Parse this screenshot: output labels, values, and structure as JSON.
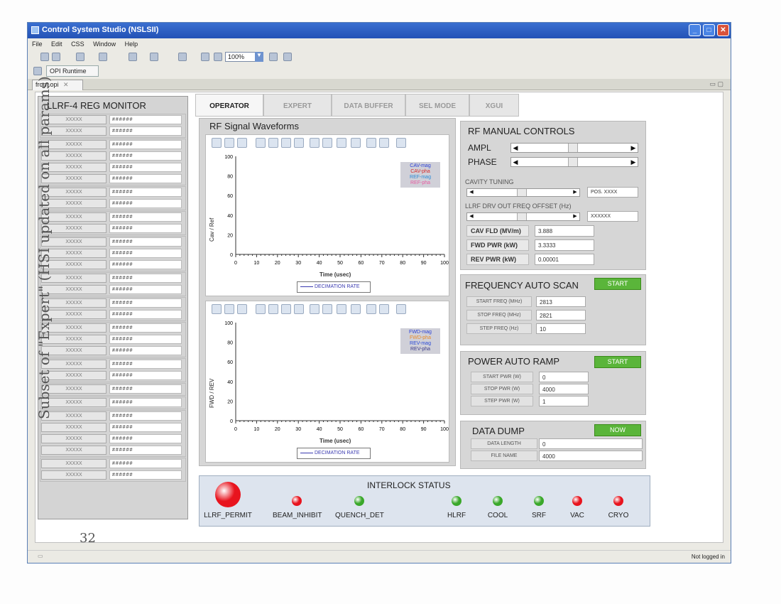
{
  "window": {
    "title": "Control System Studio (NSLSII)"
  },
  "menu": [
    "File",
    "Edit",
    "CSS",
    "Window",
    "Help"
  ],
  "toolbar": {
    "zoom": "100%"
  },
  "perspective": {
    "label": "OPI Runtime"
  },
  "editor_tab": {
    "label": "front.opi"
  },
  "status": {
    "login": "Not logged in"
  },
  "monitor": {
    "title": "LLRF-4 REG MONITOR",
    "rows": [
      {
        "key": "XXXXX",
        "val": "######"
      },
      {
        "key": "XXXXX",
        "val": "######"
      },
      {
        "key": "XXXXX",
        "val": "######"
      },
      {
        "key": "XXXXX",
        "val": "######"
      },
      {
        "key": "XXXXX",
        "val": "######"
      },
      {
        "key": "XXXXX",
        "val": "######"
      },
      {
        "key": "XXXXX",
        "val": "######"
      },
      {
        "key": "XXXXX",
        "val": "######"
      },
      {
        "key": "XXXXX",
        "val": "######"
      },
      {
        "key": "XXXXX",
        "val": "######"
      },
      {
        "key": "XXXXX",
        "val": "######"
      },
      {
        "key": "XXXXX",
        "val": "######"
      },
      {
        "key": "XXXXX",
        "val": "######"
      },
      {
        "key": "XXXXX",
        "val": "######"
      },
      {
        "key": "XXXXX",
        "val": "######"
      },
      {
        "key": "XXXXX",
        "val": "######"
      },
      {
        "key": "XXXXX",
        "val": "######"
      },
      {
        "key": "XXXXX",
        "val": "######"
      },
      {
        "key": "XXXXX",
        "val": "######"
      },
      {
        "key": "XXXXX",
        "val": "######"
      },
      {
        "key": "XXXXX",
        "val": "######"
      },
      {
        "key": "XXXXX",
        "val": "######"
      },
      {
        "key": "XXXXX",
        "val": "######"
      },
      {
        "key": "XXXXX",
        "val": "######"
      },
      {
        "key": "XXXXX",
        "val": "######"
      },
      {
        "key": "XXXXX",
        "val": "######"
      },
      {
        "key": "XXXXX",
        "val": "######"
      },
      {
        "key": "XXXXX",
        "val": "######"
      },
      {
        "key": "XXXXX",
        "val": "######"
      },
      {
        "key": "XXXXX",
        "val": "######"
      }
    ]
  },
  "tabs": [
    "OPERATOR",
    "EXPERT",
    "DATA BUFFER",
    "SEL MODE",
    "XGUI"
  ],
  "waveforms": {
    "title": "RF Signal Waveforms",
    "plot1": {
      "ylabel": "Cav / Ref",
      "xlabel": "Time (usec)",
      "yticks": [
        "100",
        "80",
        "60",
        "40",
        "20",
        "0"
      ],
      "xticks": [
        "0",
        "10",
        "20",
        "30",
        "40",
        "50",
        "60",
        "70",
        "80",
        "90",
        "100"
      ],
      "legend": [
        {
          "name": "CAV-mag",
          "color": "#2a3fd6"
        },
        {
          "name": "CAV-pha",
          "color": "#d62a2a"
        },
        {
          "name": "REF-mag",
          "color": "#2a8ad6"
        },
        {
          "name": "REF-pha",
          "color": "#e85aa0"
        }
      ],
      "decimation": "DECIMATION RATE"
    },
    "plot2": {
      "ylabel": "FWD / REV",
      "xlabel": "Time (usec)",
      "yticks": [
        "100",
        "80",
        "60",
        "40",
        "20",
        "0"
      ],
      "xticks": [
        "0",
        "10",
        "20",
        "30",
        "40",
        "50",
        "60",
        "70",
        "80",
        "90",
        "100"
      ],
      "legend": [
        {
          "name": "FWD-mag",
          "color": "#2a3fd6"
        },
        {
          "name": "FWD-pha",
          "color": "#e88a2a"
        },
        {
          "name": "REV-mag",
          "color": "#2a4ad6"
        },
        {
          "name": "REV-pha",
          "color": "#3a3a8a"
        }
      ],
      "decimation": "DECIMATION RATE"
    }
  },
  "rf_manual": {
    "title": "RF MANUAL CONTROLS",
    "ampl": "AMPL",
    "phase": "PHASE",
    "cavity_tuning": "CAVITY TUNING",
    "cavity_pos": "POS.  XXXX",
    "freq_offset": "LLRF DRV OUT FREQ OFFSET  (Hz)",
    "freq_offset_val": "XXXXXX",
    "fields": [
      {
        "label": "CAV FLD (MV/m)",
        "value": "3.888"
      },
      {
        "label": "FWD PWR (kW)",
        "value": "3.3333"
      },
      {
        "label": "REV PWR (kW)",
        "value": "0.00001"
      }
    ]
  },
  "freq_scan": {
    "title": "FREQUENCY AUTO SCAN",
    "button": "START",
    "fields": [
      {
        "label": "START FREQ (MHz)",
        "value": "2813"
      },
      {
        "label": "STOP  FREQ (MHz)",
        "value": "2821"
      },
      {
        "label": "STEP FREQ (Hz)",
        "value": "10"
      }
    ]
  },
  "power_ramp": {
    "title": "POWER AUTO RAMP",
    "button": "START",
    "fields": [
      {
        "label": "START PWR (W)",
        "value": "0"
      },
      {
        "label": "STOP  PWR (W)",
        "value": "4000"
      },
      {
        "label": "STEP PWR (W)",
        "value": "1"
      }
    ]
  },
  "data_dump": {
    "title": "DATA DUMP",
    "button": "NOW",
    "fields": [
      {
        "label": "DATA LENGTH",
        "value": "0"
      },
      {
        "label": "FILE NAME",
        "value": "4000"
      }
    ]
  },
  "interlock": {
    "title": "INTERLOCK STATUS",
    "items": [
      {
        "label": "LLRF_PERMIT",
        "state": "fault",
        "color": "#e8141e"
      },
      {
        "label": "BEAM_INHIBIT",
        "state": "fault",
        "color": "#e8141e"
      },
      {
        "label": "QUENCH_DET",
        "state": "ok",
        "color": "#3aa82a"
      },
      {
        "label": "HLRF",
        "state": "ok",
        "color": "#3aa82a"
      },
      {
        "label": "COOL",
        "state": "ok",
        "color": "#3aa82a"
      },
      {
        "label": "SRF",
        "state": "ok",
        "color": "#3aa82a"
      },
      {
        "label": "VAC",
        "state": "fault",
        "color": "#e8141e"
      },
      {
        "label": "CRYO",
        "state": "fault",
        "color": "#e8141e"
      }
    ]
  },
  "annotations": {
    "margin_note": "Subset of \"Expert\" (HSI updated on all params)",
    "page_number": "32"
  }
}
